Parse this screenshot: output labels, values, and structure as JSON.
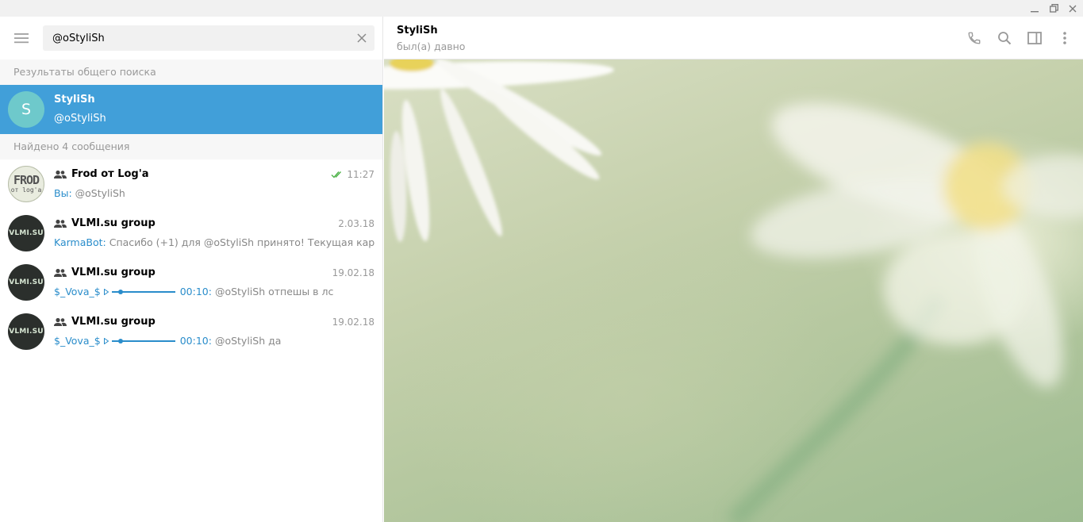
{
  "search": {
    "query": "@oStyliSh",
    "global_results_header": "Результаты общего поиска",
    "found_messages_header": "Найдено 4 сообщения"
  },
  "global_result": {
    "avatar_letter": "S",
    "name": "StyliSh",
    "username": "@oStyliSh",
    "avatar_color": "#6ec9cb"
  },
  "messages": [
    {
      "chat": "Frod от Log'a",
      "time": "11:27",
      "read": true,
      "avatar_text": [
        "FROD",
        "от log'a"
      ],
      "sender": "Вы",
      "text": "@oStyliSh"
    },
    {
      "chat": "VLMI.su group",
      "time": "2.03.18",
      "avatar_text": "VLMI.SU",
      "sender": "KarmaBot",
      "text": "Спасибо (+1) для @oStyliSh принято! Текущая карма ..."
    },
    {
      "chat": "VLMI.su group",
      "time": "19.02.18",
      "avatar_text": "VLMI.SU",
      "sender": "$_Vova_$",
      "duration": "00:10",
      "text": "@oStyliSh отпешы в лс"
    },
    {
      "chat": "VLMI.su group",
      "time": "19.02.18",
      "avatar_text": "VLMI.SU",
      "sender": "$_Vova_$",
      "duration": "00:10",
      "text": "@oStyliSh да"
    }
  ],
  "chat_header": {
    "name": "StyliSh",
    "status": "был(а) давно"
  },
  "colors": {
    "accent": "#419fd9",
    "link": "#2a8dcb",
    "muted": "#999999",
    "read_check": "#4fb34a"
  },
  "icons": {
    "menu": "hamburger-icon",
    "clear": "close-icon",
    "call": "phone-icon",
    "search": "search-icon",
    "sidebar": "sidebar-toggle-icon",
    "more": "more-vertical-icon"
  }
}
